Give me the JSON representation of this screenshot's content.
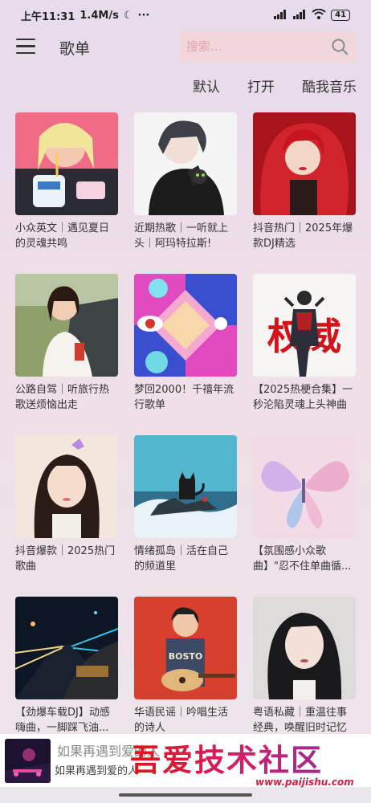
{
  "status_bar": {
    "time": "上午11:31",
    "speed": "1.4M/s",
    "battery": "41"
  },
  "header": {
    "title": "歌单",
    "search_placeholder": "搜索..."
  },
  "sort_options": [
    "默认",
    "打开",
    "酷我音乐"
  ],
  "playlists": [
    {
      "title": "小众英文｜遇见夏日的灵魂共鸣"
    },
    {
      "title": "近期热歌｜一听就上头｜阿玛特拉斯!"
    },
    {
      "title": "抖音热门｜2025年爆款DJ精选"
    },
    {
      "title": "公路自驾｜听旅行热歌送烦恼出走"
    },
    {
      "title": "梦回2000！千禧年流行歌单"
    },
    {
      "title": "【2025热梗合集】一秒沦陷灵魂上头神曲"
    },
    {
      "title": "抖音爆款｜2025热门歌曲"
    },
    {
      "title": "情绪孤岛｜活在自己的频道里"
    },
    {
      "title": "【氛围感小众歌曲】\"忍不住单曲循..."
    },
    {
      "title": "【劲爆车载DJ】动感嗨曲，一脚踩飞油..."
    },
    {
      "title": "华语民谣｜吟唱生活的诗人"
    },
    {
      "title": "粤语私藏｜重温往事经典，唤醒旧时记忆"
    }
  ],
  "cover_text": {
    "poster_chars": "权威",
    "shirt_text": "BOSTO"
  },
  "player": {
    "song": "如果再遇到爱的人",
    "lyric": "如果再遇到爱的人"
  },
  "watermark": {
    "text": "吾爱技术社区",
    "url": "www.paijishu.com"
  }
}
